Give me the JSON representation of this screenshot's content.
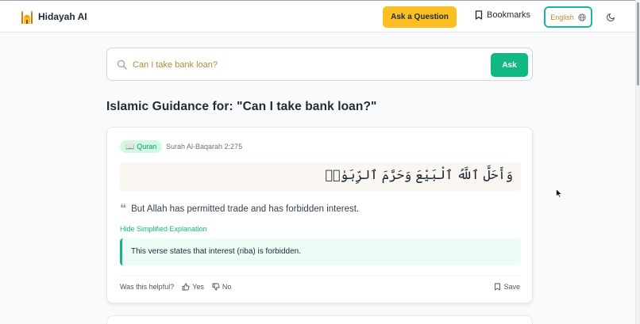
{
  "header": {
    "brand": "Hidayah AI",
    "ask_button": "Ask a Question",
    "bookmarks": "Bookmarks",
    "language": "English"
  },
  "search": {
    "value": "Can I take bank loan?",
    "button": "Ask"
  },
  "page_title": "Islamic Guidance for: \"Can I take bank loan?\"",
  "result": {
    "badge": "Quran",
    "reference": "Surah Al-Baqarah 2:275",
    "arabic": "وَأَحَلَّ ٱللَّهُ ٱلْبَيْعَ وَحَرَّمَ ٱلرِّبَوٰا۟",
    "translation": "But Allah has permitted trade and has forbidden interest.",
    "toggle_label": "Hide Simplified Explanation",
    "explanation": "This verse states that interest (riba) is forbidden.",
    "helpful_label": "Was this helpful?",
    "yes_label": "Yes",
    "no_label": "No",
    "save_label": "Save"
  },
  "colors": {
    "accent_yellow": "#fbbf24",
    "accent_green": "#10b981",
    "accent_teal": "#14b8a6"
  }
}
